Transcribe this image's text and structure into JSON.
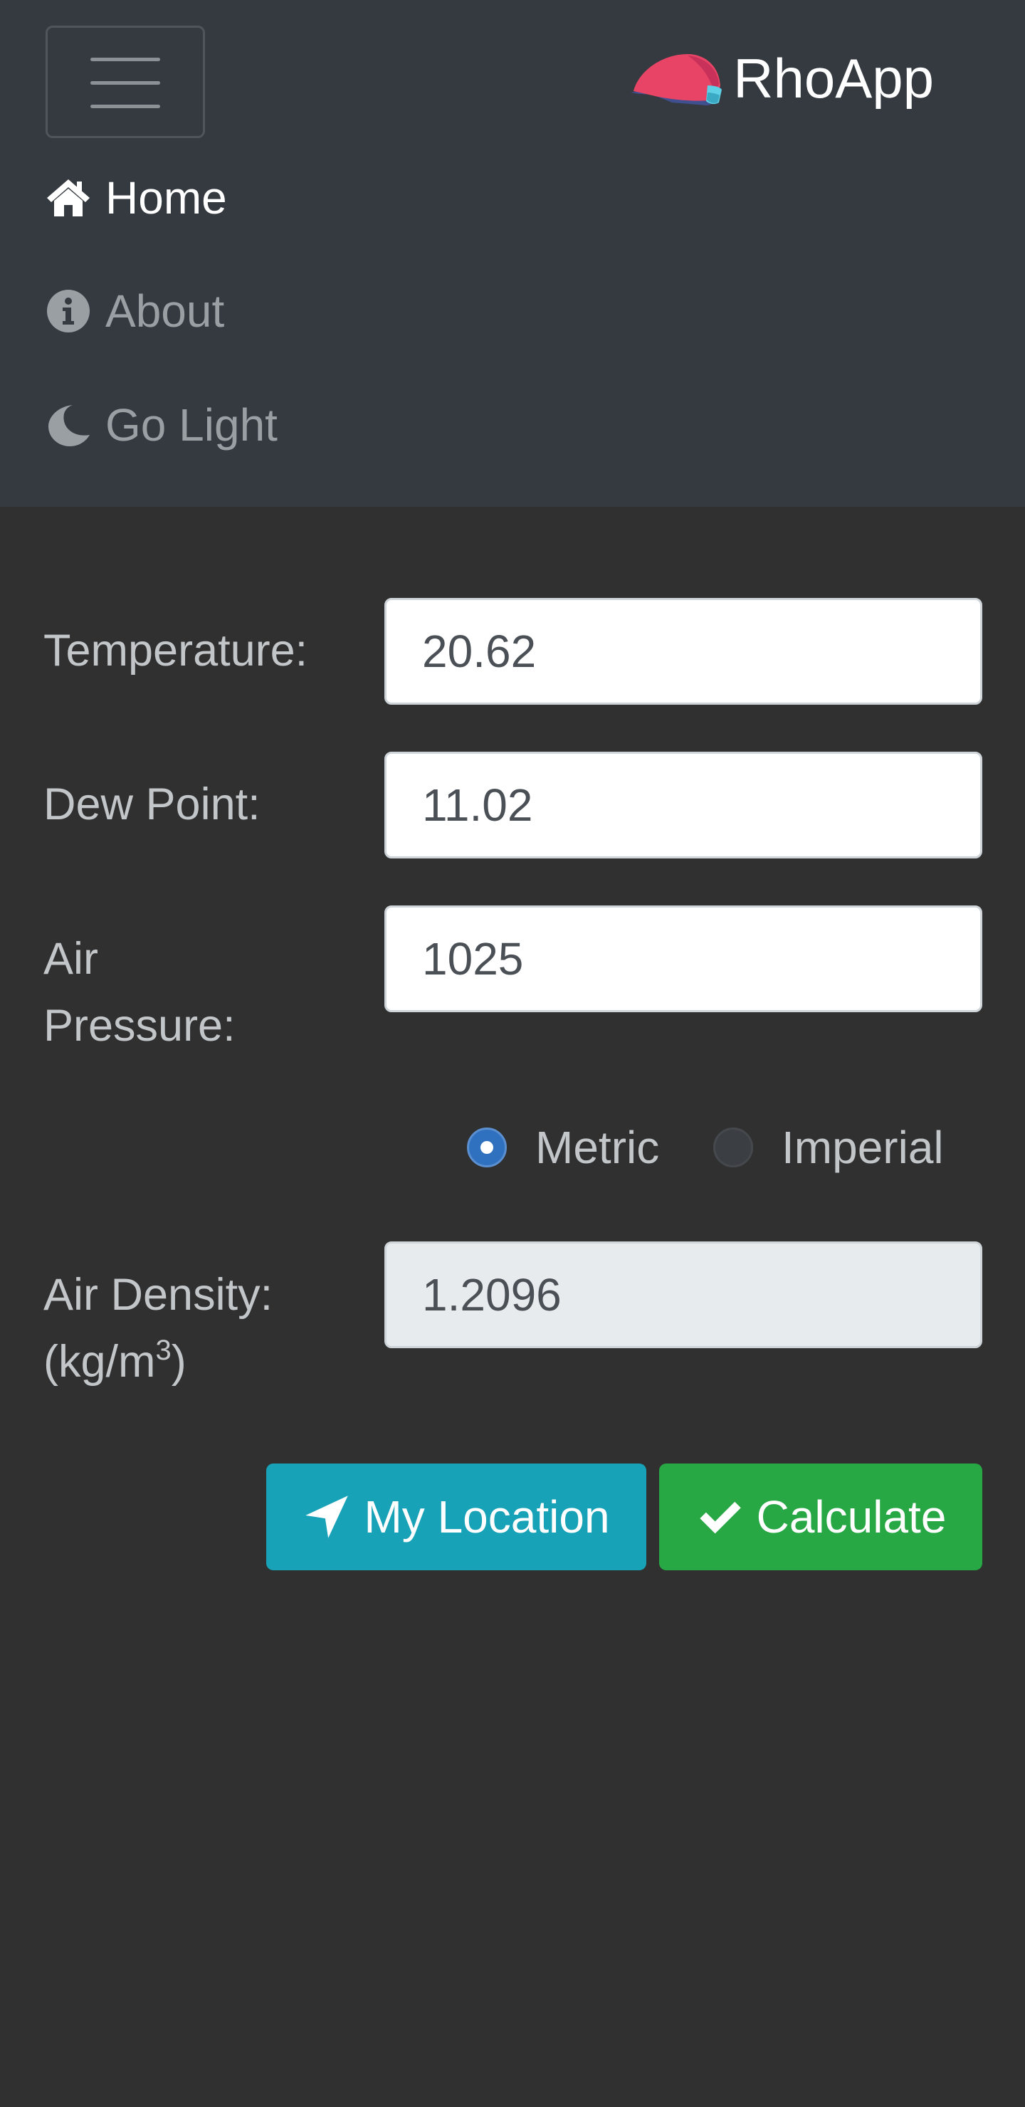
{
  "navbar": {
    "brand": "RhoApp",
    "brand_logo_icon": "cap-icon",
    "items": [
      {
        "label": "Home",
        "icon": "home-icon",
        "active": true
      },
      {
        "label": "About",
        "icon": "info-icon",
        "active": false
      },
      {
        "label": "Go Light",
        "icon": "moon-icon",
        "active": false
      }
    ]
  },
  "form": {
    "temperature": {
      "label": "Temperature:",
      "value": "20.62"
    },
    "dew_point": {
      "label": "Dew Point:",
      "value": "11.02"
    },
    "air_pressure": {
      "label_line1": "Air",
      "label_line2": "Pressure:",
      "value": "1025"
    },
    "units": {
      "options": [
        {
          "label": "Metric",
          "checked": true
        },
        {
          "label": "Imperial",
          "checked": false
        }
      ]
    },
    "air_density": {
      "label_line1": "Air Density:",
      "unit_prefix": "(kg/m",
      "unit_exponent": "3",
      "unit_suffix": ")",
      "value": "1.2096"
    }
  },
  "buttons": {
    "location": {
      "label": "My Location",
      "icon": "location-arrow-icon"
    },
    "calculate": {
      "label": "Calculate",
      "icon": "check-icon"
    }
  },
  "colors": {
    "navbar_bg": "#343a40",
    "page_bg": "#303030",
    "info": "#17a2b8",
    "success": "#28a745",
    "radio_checked": "#2f70bf"
  }
}
